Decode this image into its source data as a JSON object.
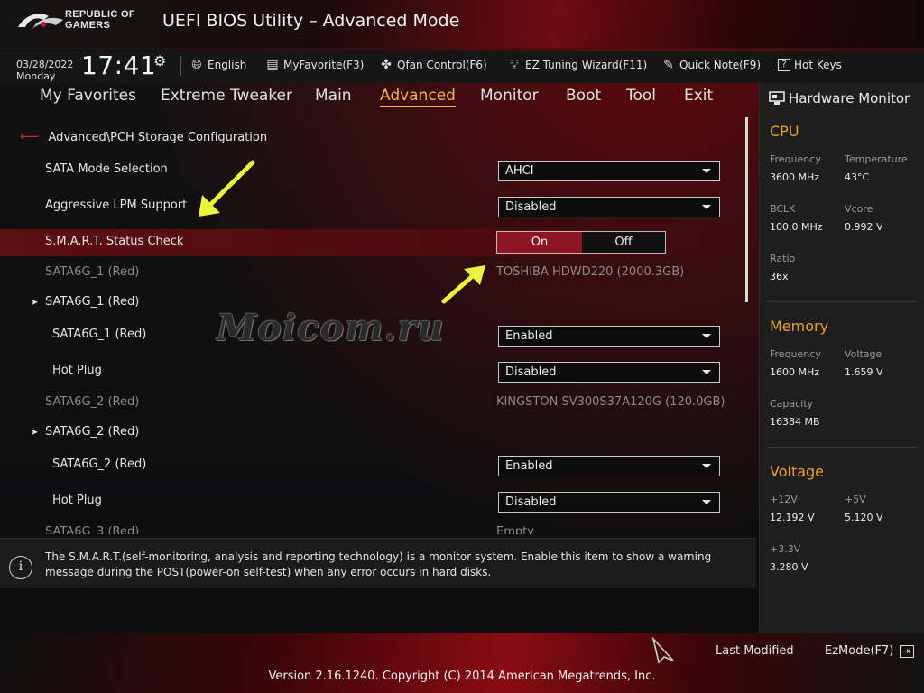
{
  "header": {
    "brand_line1": "REPUBLIC OF",
    "brand_line2": "GAMERS",
    "title": "UEFI BIOS Utility – Advanced Mode"
  },
  "infobar": {
    "date": "03/28/2022",
    "day": "Monday",
    "time": "17:41",
    "items": [
      {
        "icon": "globe-icon",
        "label": "English"
      },
      {
        "icon": "favorite-icon",
        "label": "MyFavorite(F3)"
      },
      {
        "icon": "fan-icon",
        "label": "Qfan Control(F6)"
      },
      {
        "icon": "bulb-icon",
        "label": "EZ Tuning Wizard(F11)"
      },
      {
        "icon": "note-icon",
        "label": "Quick Note(F9)"
      },
      {
        "icon": "help-icon",
        "label": "Hot Keys"
      }
    ]
  },
  "tabs": [
    {
      "label": "My Favorites",
      "active": false
    },
    {
      "label": "Extreme Tweaker",
      "active": false
    },
    {
      "label": "Main",
      "active": false
    },
    {
      "label": "Advanced",
      "active": true
    },
    {
      "label": "Monitor",
      "active": false
    },
    {
      "label": "Boot",
      "active": false
    },
    {
      "label": "Tool",
      "active": false
    },
    {
      "label": "Exit",
      "active": false
    }
  ],
  "breadcrumb": "Advanced\\PCH Storage Configuration",
  "settings": {
    "sata_mode": {
      "label": "SATA Mode Selection",
      "value": "AHCI"
    },
    "aggressive_lpm": {
      "label": "Aggressive LPM Support",
      "value": "Disabled"
    },
    "smart": {
      "label": "S.M.A.R.T. Status Check",
      "on": "On",
      "off": "Off",
      "selected": "On"
    },
    "sata1_info": {
      "label": "SATA6G_1 (Red)",
      "value": "TOSHIBA HDWD220 (2000.3GB)"
    },
    "sata1_group": {
      "label": "SATA6G_1 (Red)"
    },
    "sata1_enable": {
      "label": "SATA6G_1 (Red)",
      "value": "Enabled"
    },
    "sata1_hotplug": {
      "label": "Hot Plug",
      "value": "Disabled"
    },
    "sata2_info": {
      "label": "SATA6G_2 (Red)",
      "value": "KINGSTON SV300S37A120G (120.0GB)"
    },
    "sata2_group": {
      "label": "SATA6G_2 (Red)"
    },
    "sata2_enable": {
      "label": "SATA6G_2 (Red)",
      "value": "Enabled"
    },
    "sata2_hotplug": {
      "label": "Hot Plug",
      "value": "Disabled"
    },
    "sata3_info_partial": {
      "label": "SATA6G_3 (Red)",
      "value": "Empty"
    }
  },
  "watermark": "Moicom.ru",
  "help": {
    "text": "The S.M.A.R.T.(self-monitoring, analysis and reporting technology) is a monitor system. Enable this item to show a warning message during the POST(power-on self-test) when any error occurs in hard disks."
  },
  "hw_monitor": {
    "title": "Hardware Monitor",
    "cpu": {
      "heading": "CPU",
      "frequency_label": "Frequency",
      "frequency": "3600 MHz",
      "temperature_label": "Temperature",
      "temperature": "43°C",
      "bclk_label": "BCLK",
      "bclk": "100.0 MHz",
      "vcore_label": "Vcore",
      "vcore": "0.992 V",
      "ratio_label": "Ratio",
      "ratio": "36x"
    },
    "memory": {
      "heading": "Memory",
      "frequency_label": "Frequency",
      "frequency": "1600 MHz",
      "voltage_label": "Voltage",
      "voltage": "1.659 V",
      "capacity_label": "Capacity",
      "capacity": "16384 MB"
    },
    "voltage": {
      "heading": "Voltage",
      "v12_label": "+12V",
      "v12": "12.192 V",
      "v5_label": "+5V",
      "v5": "5.120 V",
      "v33_label": "+3.3V",
      "v33": "3.280 V"
    }
  },
  "footer": {
    "last_modified": "Last Modified",
    "ez_mode": "EzMode(F7)",
    "version": "Version 2.16.1240. Copyright (C) 2014 American Megatrends, Inc."
  },
  "colors": {
    "accent_orange": "#f0a030",
    "active_tab": "#ffb347",
    "selection_red": "#8e1624",
    "arrow_yellow": "#e8f53a"
  }
}
